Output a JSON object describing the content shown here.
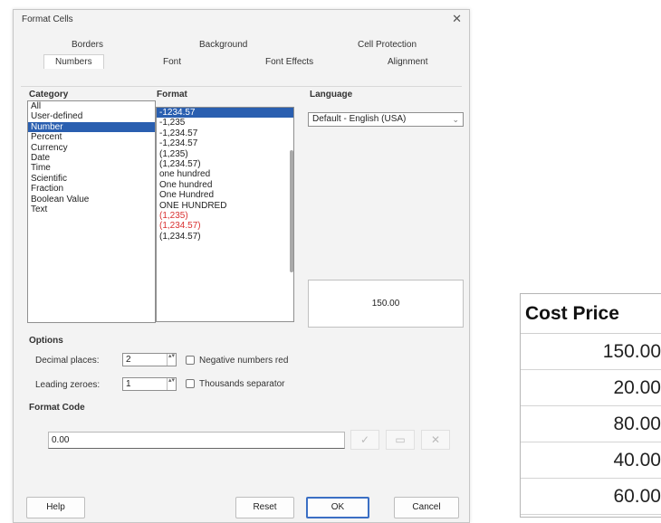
{
  "dialog": {
    "title": "Format Cells",
    "close_glyph": "✕",
    "tabs_row1": [
      "Borders",
      "Background",
      "Cell Protection"
    ],
    "tabs_row2": [
      "Numbers",
      "Font",
      "Font Effects",
      "Alignment"
    ],
    "active_tab": "Numbers"
  },
  "category": {
    "label": "Category",
    "items": [
      "All",
      "User-defined",
      "Number",
      "Percent",
      "Currency",
      "Date",
      "Time",
      "Scientific",
      "Fraction",
      "Boolean Value",
      "Text"
    ],
    "selected": "Number"
  },
  "format": {
    "label": "Format",
    "items": [
      {
        "text": "-1234.57",
        "red": false,
        "selected": true
      },
      {
        "text": "-1,235",
        "red": false,
        "selected": false
      },
      {
        "text": "-1,234.57",
        "red": false,
        "selected": false
      },
      {
        "text": "-1,234.57",
        "red": false,
        "selected": false
      },
      {
        "text": "(1,235)",
        "red": false,
        "selected": false
      },
      {
        "text": "(1,234.57)",
        "red": false,
        "selected": false
      },
      {
        "text": "one hundred",
        "red": false,
        "selected": false
      },
      {
        "text": "One hundred",
        "red": false,
        "selected": false
      },
      {
        "text": "One Hundred",
        "red": false,
        "selected": false
      },
      {
        "text": "ONE HUNDRED",
        "red": false,
        "selected": false
      },
      {
        "text": "(1,235)",
        "red": true,
        "selected": false
      },
      {
        "text": "(1,234.57)",
        "red": true,
        "selected": false
      },
      {
        "text": "(1,234.57)",
        "red": false,
        "selected": false
      }
    ]
  },
  "language": {
    "label": "Language",
    "value": "Default - English (USA)",
    "arrow": "⌄"
  },
  "preview": {
    "value": "150.00"
  },
  "options": {
    "label": "Options",
    "decimal_places_label": "Decimal places:",
    "decimal_places_value": "2",
    "leading_zeroes_label": "Leading zeroes:",
    "leading_zeroes_value": "1",
    "negative_red_label": "Negative numbers red",
    "thousands_sep_label": "Thousands separator",
    "spin_glyph": "▴▾"
  },
  "format_code": {
    "label": "Format Code",
    "value": "0.00",
    "icons": [
      "✓",
      "▭",
      "✕"
    ]
  },
  "buttons": {
    "help": "Help",
    "reset": "Reset",
    "ok": "OK",
    "cancel": "Cancel"
  },
  "spreadsheet": {
    "header": "Cost Price",
    "values": [
      "150.00",
      "20.00",
      "80.00",
      "40.00",
      "60.00"
    ]
  },
  "colors": {
    "selection": "#2a5fb0",
    "negative_red": "#d93030",
    "ok_border": "#3b6fc4"
  }
}
